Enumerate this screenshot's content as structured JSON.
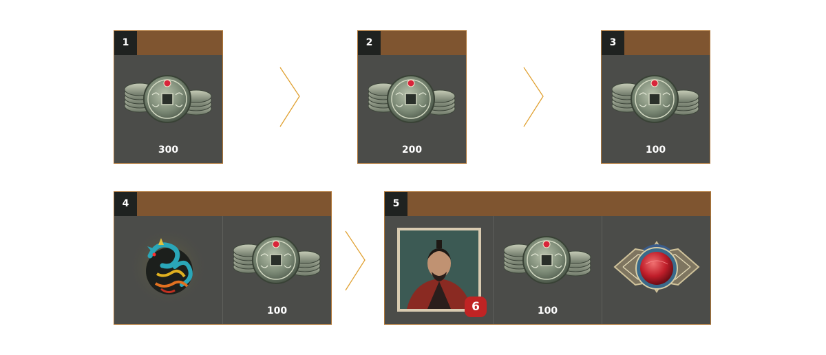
{
  "steps": [
    {
      "number": "1",
      "rewards": [
        {
          "icon": "coin-stack-icon",
          "quantity": "300"
        }
      ]
    },
    {
      "number": "2",
      "rewards": [
        {
          "icon": "coin-stack-icon",
          "quantity": "200"
        }
      ]
    },
    {
      "number": "3",
      "rewards": [
        {
          "icon": "coin-stack-icon",
          "quantity": "100"
        }
      ]
    },
    {
      "number": "4",
      "rewards": [
        {
          "icon": "dragon-emblem-icon"
        },
        {
          "icon": "coin-stack-icon",
          "quantity": "100"
        }
      ]
    },
    {
      "number": "5",
      "rewards": [
        {
          "icon": "hero-portrait-icon",
          "level": "6"
        },
        {
          "icon": "coin-stack-icon",
          "quantity": "100"
        },
        {
          "icon": "red-gem-ornament-icon"
        }
      ]
    }
  ],
  "colors": {
    "header": "#7f5530",
    "card_body": "#4b4c49",
    "border": "#b0783a",
    "arrow": "#e0a030",
    "level_badge": "#c02424"
  }
}
